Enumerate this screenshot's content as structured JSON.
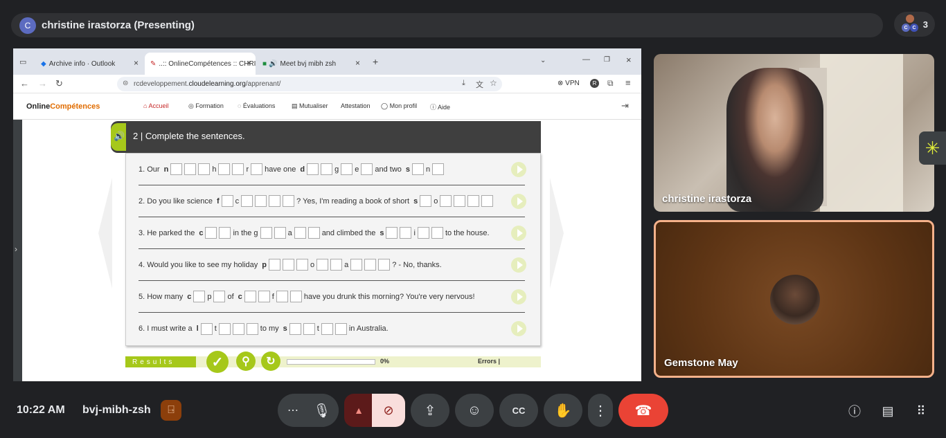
{
  "meeting": {
    "presenter_initial": "C",
    "presenter_title": "christine irastorza (Presenting)",
    "participant_count": "3",
    "time": "10:22 AM",
    "code": "bvj-mibh-zsh"
  },
  "browser": {
    "tabs": [
      {
        "label": "Archive   info ·   Outlook"
      },
      {
        "label": "..:: OnlineCompétences :: CHRI"
      },
      {
        "label": "Meet   bvj mibh zsh"
      }
    ],
    "url_host": "rcdeveloppement.",
    "url_domain": "cloudelearning.org",
    "url_path": "/apprenant/",
    "vpn_label": "VPN",
    "profile_letter": "R"
  },
  "site": {
    "logo_part1": "Online",
    "logo_part2": "Compétences",
    "nav": [
      "Accueil",
      "Formation",
      "Évaluations",
      "Mutualiser",
      "Attestation",
      "Mon profil",
      "Aide"
    ]
  },
  "exercise": {
    "title": "2 | Complete the sentences.",
    "rows": [
      {
        "segments": [
          "1. Our",
          "n",
          "h",
          "r",
          "have one",
          "d",
          "g",
          "e",
          "and two",
          "s",
          "n"
        ]
      },
      {
        "segments": [
          "2. Do you like science",
          "f",
          "c",
          "? Yes, I'm reading a book of short",
          "s",
          "o"
        ]
      },
      {
        "segments": [
          "3. He parked the",
          "c",
          "in the g",
          "a",
          "and climbed the",
          "s",
          "i",
          "to the house."
        ]
      },
      {
        "segments": [
          "4. Would you like to see my holiday",
          "p",
          "o",
          "a",
          "? - No, thanks."
        ]
      },
      {
        "segments": [
          "5. How many",
          "c",
          "p",
          "of",
          "c",
          "f",
          "have you drunk this morning? You're very nervous!"
        ]
      },
      {
        "segments": [
          "6. I must write a",
          "l",
          "t",
          "to my",
          "s",
          "t",
          "in Australia."
        ]
      }
    ],
    "results_label": "Results",
    "progress_text": "0%",
    "progress_value": 0,
    "errors_label": "Errors |"
  },
  "tiles": [
    {
      "name": "christine irastorza"
    },
    {
      "name": "Gemstone May"
    }
  ],
  "colors": {
    "accent_green": "#a6c81a",
    "hangup_red": "#ea4335",
    "brand_orange": "#e06c00"
  }
}
